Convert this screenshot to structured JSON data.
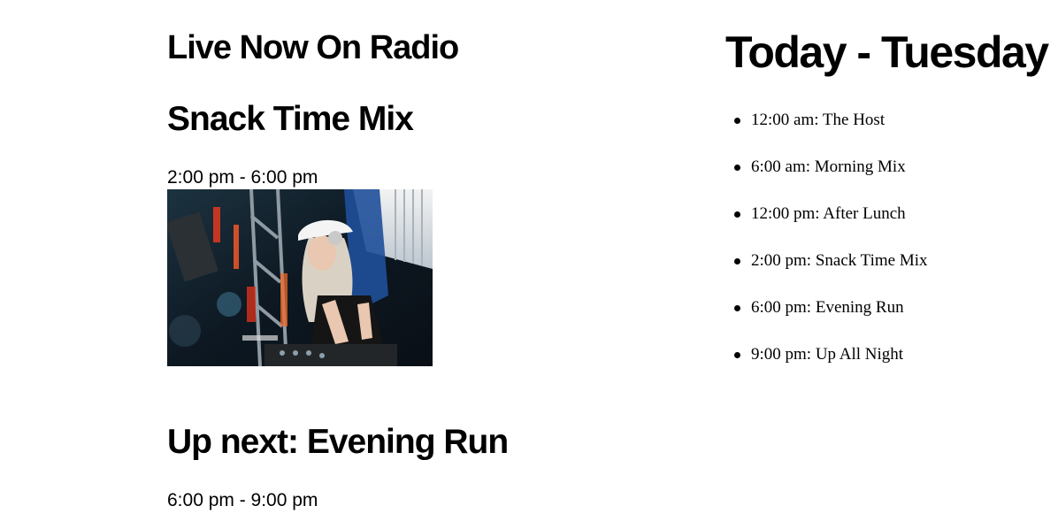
{
  "live": {
    "heading": "Live Now On Radio",
    "show_title": "Snack Time Mix",
    "show_time": "2:00 pm - 6:00 pm",
    "image_icon": "dj-photo"
  },
  "up_next": {
    "heading": "Up next: Evening Run",
    "time": "6:00 pm - 9:00 pm"
  },
  "today": {
    "heading": "Today - Tuesday",
    "schedule": [
      "12:00 am: The Host",
      "6:00 am: Morning Mix",
      "12:00 pm: After Lunch",
      "2:00 pm: Snack Time Mix",
      "6:00 pm: Evening Run",
      "9:00 pm: Up All Night"
    ]
  }
}
